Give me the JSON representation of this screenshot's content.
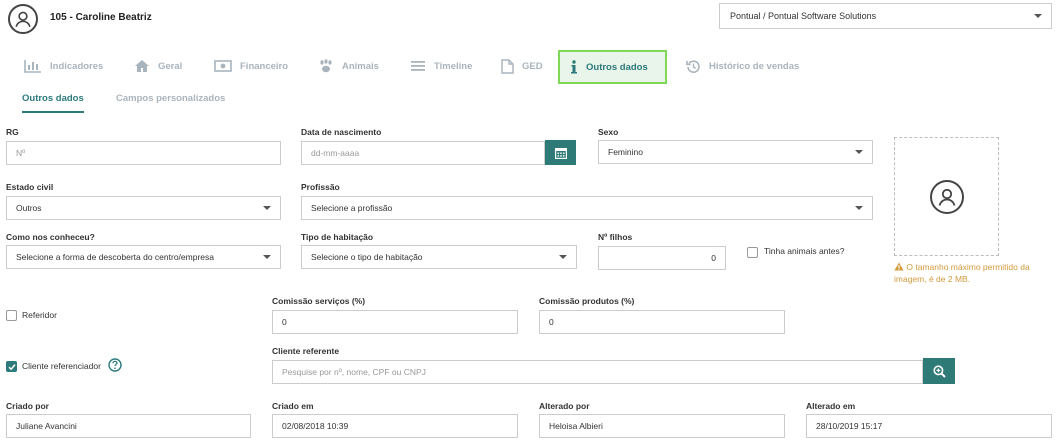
{
  "client": {
    "title": "105 - Caroline Beatriz"
  },
  "company": {
    "selected": "Pontual / Pontual Software Solutions"
  },
  "tabs": [
    {
      "label": "Indicadores",
      "icon": "bar-chart-icon"
    },
    {
      "label": "Geral",
      "icon": "home-icon"
    },
    {
      "label": "Financeiro",
      "icon": "money-icon"
    },
    {
      "label": "Animais",
      "icon": "paw-icon"
    },
    {
      "label": "Timeline",
      "icon": "list-icon"
    },
    {
      "label": "GED",
      "icon": "document-icon"
    },
    {
      "label": "Outros dados",
      "icon": "info-icon",
      "active": true
    },
    {
      "label": "Histórico de vendas",
      "icon": "history-icon"
    }
  ],
  "subtabs": {
    "active": "Outros dados",
    "inactive": "Campos personalizados"
  },
  "form": {
    "rg": {
      "label": "RG",
      "placeholder": "Nº"
    },
    "birth": {
      "label": "Data de nascimento",
      "placeholder": "dd-mm-aaaa"
    },
    "sex": {
      "label": "Sexo",
      "value": "Feminino"
    },
    "civil": {
      "label": "Estado civil",
      "value": "Outros"
    },
    "profession": {
      "label": "Profissão",
      "placeholder": "Selecione a profissão"
    },
    "how": {
      "label": "Como nos conheceu?",
      "placeholder": "Selecione a forma de descoberta do centro/empresa"
    },
    "housing": {
      "label": "Tipo de habitação",
      "placeholder": "Selecione o tipo de habitação"
    },
    "children": {
      "label": "Nº filhos",
      "value": "0"
    },
    "had_animals": {
      "label": "Tinha animais antes?"
    },
    "referrer": {
      "label": "Referidor"
    },
    "services_commission": {
      "label": "Comissão serviços (%)",
      "value": "0"
    },
    "products_commission": {
      "label": "Comissão produtos (%)",
      "value": "0"
    },
    "referenced_client": {
      "label": "Cliente referenciador",
      "checked": true
    },
    "referring_client": {
      "label": "Cliente referente",
      "placeholder": "Pesquise por nº,  nome, CPF ou CNPJ"
    },
    "created_by": {
      "label": "Criado por",
      "value": "Juliane Avancini"
    },
    "created_at": {
      "label": "Criado em",
      "value": "02/08/2018 10:39"
    },
    "changed_by": {
      "label": "Alterado por",
      "value": "Heloisa Albieri"
    },
    "changed_at": {
      "label": "Alterado em",
      "value": "28/10/2019 15:17"
    }
  },
  "photo": {
    "warning": "O tamanho máximo permitido da imagem, é de 2 MB."
  },
  "colors": {
    "accent": "#2c7a7b",
    "button": "#2d7a77",
    "active_tab_border": "#7ed957",
    "warning": "#d49a3c"
  }
}
